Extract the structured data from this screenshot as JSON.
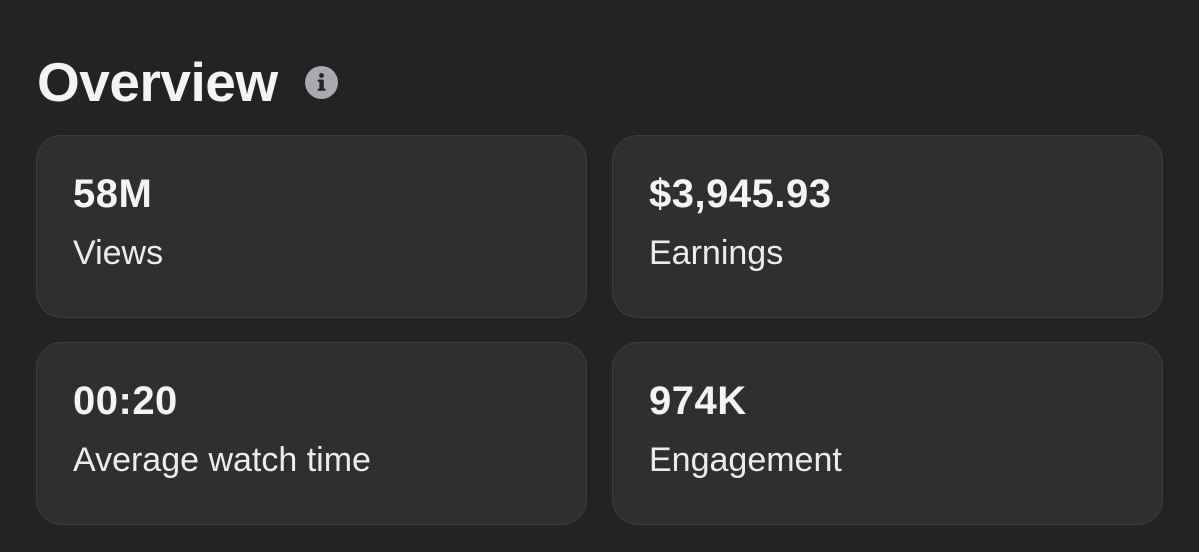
{
  "header": {
    "title": "Overview",
    "info_icon": "info-icon"
  },
  "metrics": [
    {
      "value": "58M",
      "label": "Views"
    },
    {
      "value": "$3,945.93",
      "label": "Earnings"
    },
    {
      "value": "00:20",
      "label": "Average watch time"
    },
    {
      "value": "974K",
      "label": "Engagement"
    }
  ],
  "colors": {
    "background": "#232325",
    "card": "#2f2f32",
    "card_border": "#3d3d41",
    "text": "#f4f4f6",
    "info_icon": "#a9a9ae"
  }
}
